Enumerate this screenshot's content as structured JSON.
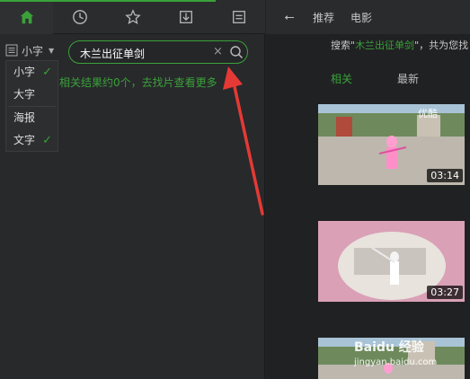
{
  "left_panel": {
    "view_selector": {
      "label": "小字"
    },
    "dropdown": {
      "items": [
        {
          "label": "小字",
          "checked": true
        },
        {
          "label": "大字",
          "checked": false
        },
        {
          "label": "海报",
          "checked": false
        },
        {
          "label": "文字",
          "checked": true
        }
      ]
    },
    "search": {
      "value": "木兰出征单剑",
      "clear_glyph": "×"
    },
    "no_result_text": "相关结果约0个，去找片查看更多"
  },
  "right_panel": {
    "back_glyph": "⭠",
    "nav_tabs": [
      "推荐",
      "电影"
    ],
    "hint_prefix": "搜索\"",
    "hint_keyword": "木兰出征单剑",
    "hint_suffix": "\"，共为您找",
    "subtabs": [
      "相关",
      "最新"
    ],
    "videos": [
      {
        "duration": "03:14",
        "watermark": "优酷"
      },
      {
        "duration": "03:27",
        "watermark": ""
      },
      {
        "duration": "",
        "watermark": "Baidu 经验"
      }
    ],
    "watermark_sub": "jingyan.baidu.com"
  },
  "colors": {
    "accent": "#3aa13a",
    "annotation": "#e53935"
  },
  "icons": [
    "home-icon",
    "clock-icon",
    "star-icon",
    "download-icon",
    "list-icon",
    "search-icon",
    "close-icon",
    "back-icon",
    "check-icon"
  ]
}
